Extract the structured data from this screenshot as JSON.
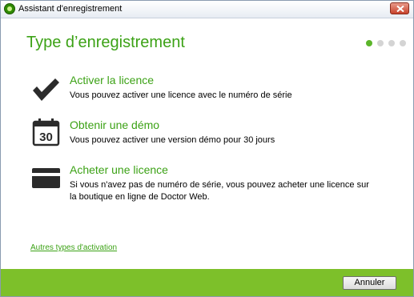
{
  "window": {
    "title": "Assistant d'enregistrement"
  },
  "heading": "Type d’enregistrement",
  "steps": {
    "total": 4,
    "current": 1
  },
  "options": [
    {
      "icon": "checkmark-icon",
      "title": "Activer la licence",
      "description": "Vous pouvez activer une licence avec le numéro de série"
    },
    {
      "icon": "calendar-icon",
      "calendar_number": "30",
      "title": "Obtenir une démo",
      "description": "Vous pouvez activer une version démo pour 30 jours"
    },
    {
      "icon": "credit-card-icon",
      "title": "Acheter une licence",
      "description": "Si vous n'avez pas de numéro de série, vous pouvez acheter une licence sur la boutique en ligne de Doctor Web."
    }
  ],
  "other_link": "Autres types d'activation",
  "footer": {
    "cancel_label": "Annuler"
  },
  "colors": {
    "accent": "#3ca216",
    "footer": "#7dc02a",
    "dot_active": "#5bb52a",
    "dot_inactive": "#d4d4d4"
  }
}
